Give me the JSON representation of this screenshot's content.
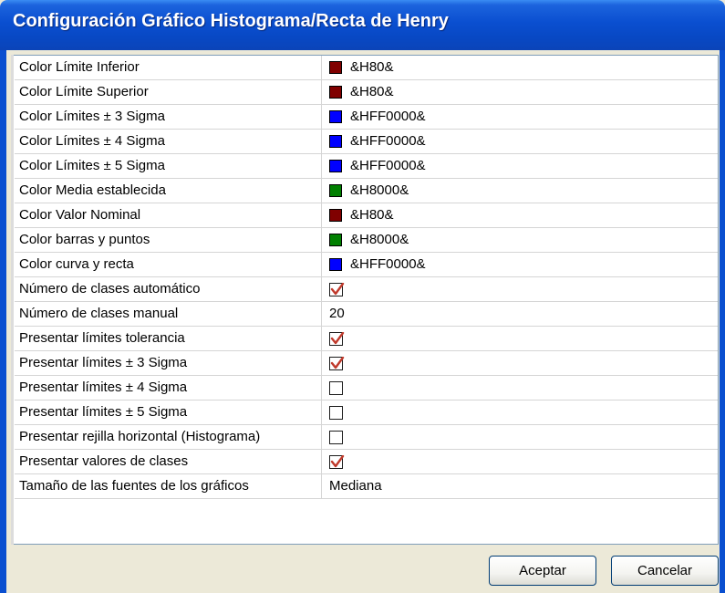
{
  "window": {
    "title": "Configuración Gráfico Histograma/Recta de Henry"
  },
  "colors": {
    "darkred": "#800000",
    "blue": "#0000ff",
    "green": "#008000",
    "check": "#c0392b"
  },
  "rows": [
    {
      "label": "Color Límite Inferior",
      "type": "color",
      "swatch": "#800000",
      "value": "&H80&"
    },
    {
      "label": "Color Límite Superior",
      "type": "color",
      "swatch": "#800000",
      "value": "&H80&"
    },
    {
      "label": "Color Límites ± 3 Sigma",
      "type": "color",
      "swatch": "#0000ff",
      "value": "&HFF0000&"
    },
    {
      "label": "Color Límites ± 4 Sigma",
      "type": "color",
      "swatch": "#0000ff",
      "value": "&HFF0000&"
    },
    {
      "label": "Color Límites ± 5 Sigma",
      "type": "color",
      "swatch": "#0000ff",
      "value": "&HFF0000&"
    },
    {
      "label": "Color Media establecida",
      "type": "color",
      "swatch": "#008000",
      "value": "&H8000&"
    },
    {
      "label": "Color Valor Nominal",
      "type": "color",
      "swatch": "#800000",
      "value": "&H80&"
    },
    {
      "label": "Color barras y puntos",
      "type": "color",
      "swatch": "#008000",
      "value": "&H8000&"
    },
    {
      "label": "Color curva y recta",
      "type": "color",
      "swatch": "#0000ff",
      "value": "&HFF0000&"
    },
    {
      "label": "Número de clases automático",
      "type": "check",
      "checked": true
    },
    {
      "label": "Número de clases manual",
      "type": "text",
      "value": "20"
    },
    {
      "label": "Presentar límites tolerancia",
      "type": "check",
      "checked": true
    },
    {
      "label": "Presentar límites ± 3 Sigma",
      "type": "check",
      "checked": true
    },
    {
      "label": "Presentar límites ± 4 Sigma",
      "type": "check",
      "checked": false
    },
    {
      "label": "Presentar límites ± 5 Sigma",
      "type": "check",
      "checked": false
    },
    {
      "label": "Presentar rejilla horizontal (Histograma)",
      "type": "check",
      "checked": false
    },
    {
      "label": "Presentar valores de clases",
      "type": "check",
      "checked": true
    },
    {
      "label": "Tamaño de las fuentes de los gráficos",
      "type": "text",
      "value": "Mediana"
    }
  ],
  "buttons": {
    "ok": "Aceptar",
    "cancel": "Cancelar"
  }
}
